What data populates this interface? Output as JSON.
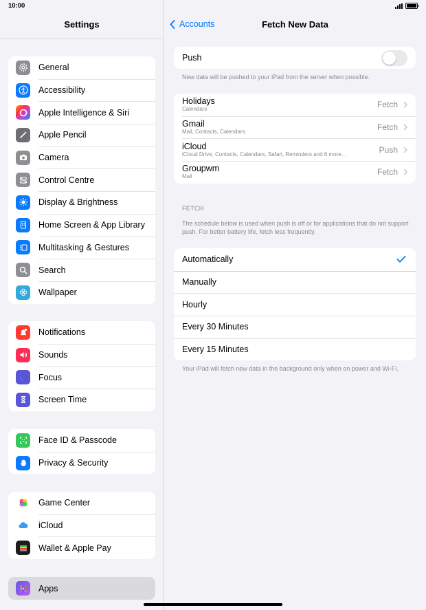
{
  "status": {
    "time": "10:00"
  },
  "sidebar": {
    "title": "Settings",
    "groups": [
      [
        {
          "label": "General",
          "icon": "gear-icon",
          "color": "#8e8e93"
        },
        {
          "label": "Accessibility",
          "icon": "accessibility-icon",
          "color": "#0a7aff"
        },
        {
          "label": "Apple Intelligence & Siri",
          "icon": "siri-icon",
          "color": "#ff6b9a"
        },
        {
          "label": "Apple Pencil",
          "icon": "pencil-icon",
          "color": "#6e6e73"
        },
        {
          "label": "Camera",
          "icon": "camera-icon",
          "color": "#8e8e93"
        },
        {
          "label": "Control Centre",
          "icon": "control-centre-icon",
          "color": "#8e8e93"
        },
        {
          "label": "Display & Brightness",
          "icon": "brightness-icon",
          "color": "#0a7aff"
        },
        {
          "label": "Home Screen & App Library",
          "icon": "home-screen-icon",
          "color": "#0a7aff"
        },
        {
          "label": "Multitasking & Gestures",
          "icon": "multitasking-icon",
          "color": "#0a7aff"
        },
        {
          "label": "Search",
          "icon": "search-icon",
          "color": "#8e8e93"
        },
        {
          "label": "Wallpaper",
          "icon": "wallpaper-icon",
          "color": "#34aadc"
        }
      ],
      [
        {
          "label": "Notifications",
          "icon": "notifications-icon",
          "color": "#ff3b30"
        },
        {
          "label": "Sounds",
          "icon": "sounds-icon",
          "color": "#ff2d55"
        },
        {
          "label": "Focus",
          "icon": "focus-icon",
          "color": "#5856d6"
        },
        {
          "label": "Screen Time",
          "icon": "hourglass-icon",
          "color": "#5856d6"
        }
      ],
      [
        {
          "label": "Face ID & Passcode",
          "icon": "face-id-icon",
          "color": "#34c759"
        },
        {
          "label": "Privacy & Security",
          "icon": "hand-icon",
          "color": "#0a7aff"
        }
      ],
      [
        {
          "label": "Game Center",
          "icon": "game-center-icon",
          "color": "#ffffff"
        },
        {
          "label": "iCloud",
          "icon": "icloud-icon",
          "color": "#ffffff"
        },
        {
          "label": "Wallet & Apple Pay",
          "icon": "wallet-icon",
          "color": "#1c1c1e"
        }
      ]
    ],
    "apps": {
      "label": "Apps",
      "icon": "apps-icon",
      "color": "#5856d6"
    }
  },
  "detail": {
    "back_label": "Accounts",
    "title": "Fetch New Data",
    "push": {
      "label": "Push",
      "on": false
    },
    "push_note": "New data will be pushed to your iPad from the server when possible.",
    "accounts": [
      {
        "name": "Holidays",
        "sub": "Calendars",
        "value": "Fetch"
      },
      {
        "name": "Gmail",
        "sub": "Mail, Contacts, Calendars",
        "value": "Fetch"
      },
      {
        "name": "iCloud",
        "sub": "iCloud Drive, Contacts, Calendars, Safari, Reminders and 6 more…",
        "value": "Push"
      },
      {
        "name": "Groupwm",
        "sub": "Mail",
        "value": "Fetch"
      }
    ],
    "fetch_header": "FETCH",
    "fetch_note": "The schedule below is used when push is off or for applications that do not support push. For better battery life, fetch less frequently.",
    "options": [
      {
        "label": "Automatically",
        "selected": true
      },
      {
        "label": "Manually",
        "selected": false
      },
      {
        "label": "Hourly",
        "selected": false
      },
      {
        "label": "Every 30 Minutes",
        "selected": false
      },
      {
        "label": "Every 15 Minutes",
        "selected": false
      }
    ],
    "bottom_note": "Your iPad will fetch new data in the background only when on power and Wi-Fi."
  },
  "colors": {
    "accent": "#007aff"
  }
}
